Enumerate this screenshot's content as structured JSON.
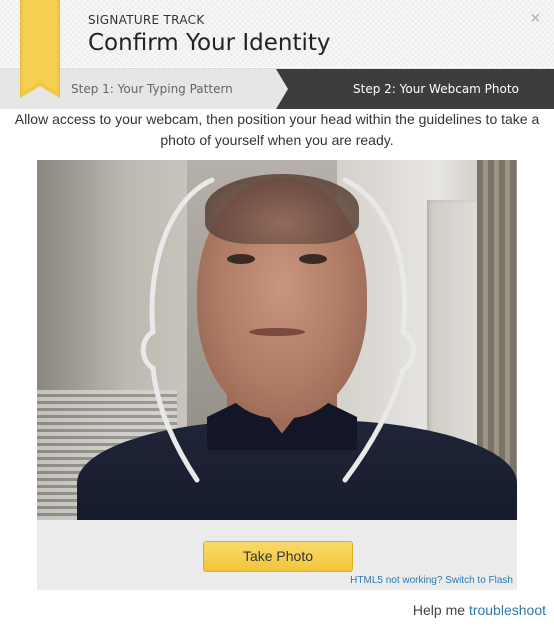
{
  "header": {
    "eyebrow": "SIGNATURE TRACK",
    "title": "Confirm Your Identity",
    "close_label": "×"
  },
  "steps": {
    "step1": "Step 1: Your Typing Pattern",
    "step2": "Step 2: Your Webcam Photo",
    "active": 2
  },
  "instructions": "Allow access to your webcam, then position your head within the guidelines to take a photo of yourself when you are ready.",
  "controls": {
    "take_photo_label": "Take Photo",
    "flash_link": "HTML5 not working? Switch to Flash"
  },
  "help": {
    "prefix": "Help me",
    "link": "troubleshoot"
  },
  "colors": {
    "ribbon": "#f2c741",
    "active_step_bg": "#3d3d3d",
    "button": "#f2c63a",
    "link": "#2a7ab0"
  }
}
